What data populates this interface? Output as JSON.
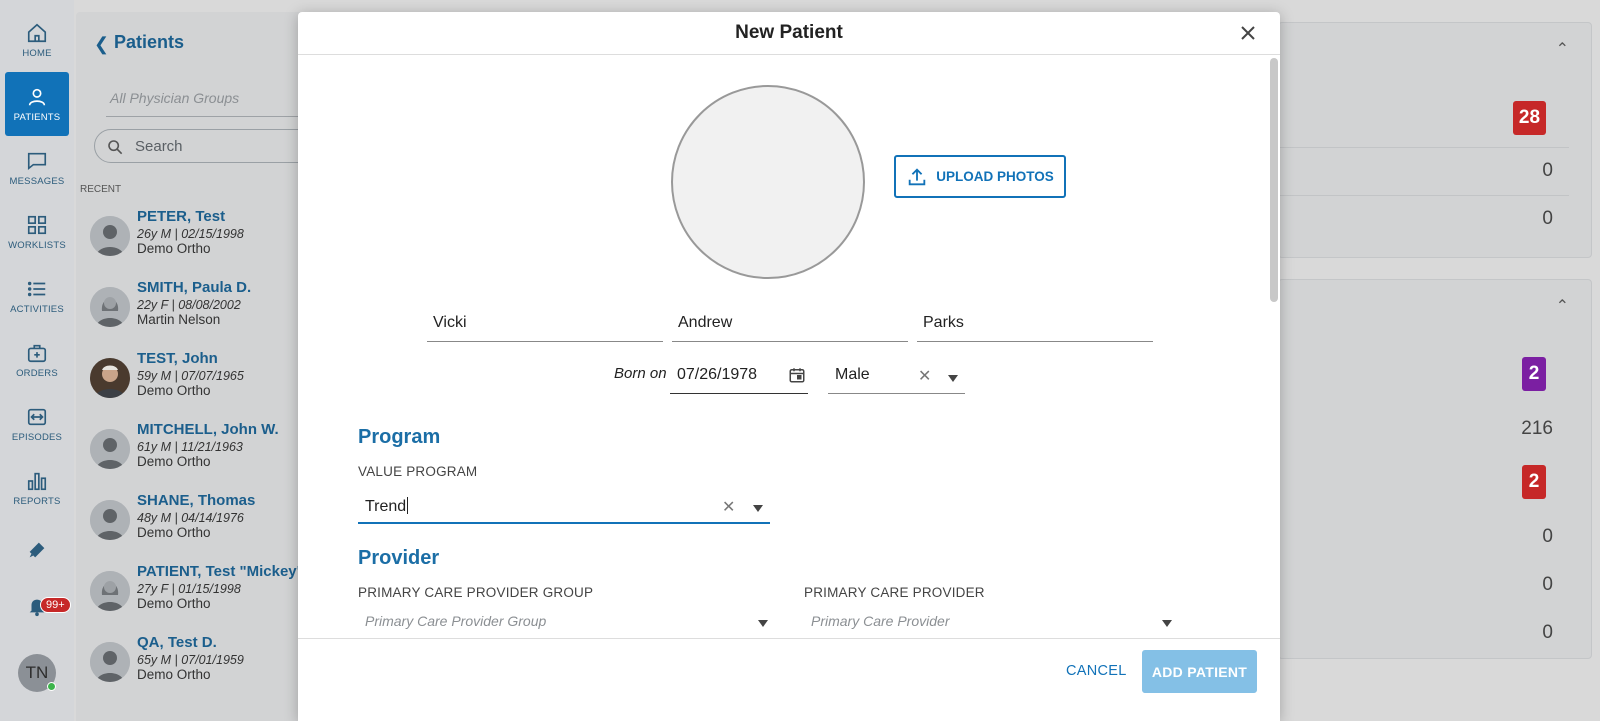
{
  "nav": {
    "items": [
      {
        "label": "HOME",
        "icon": "home-icon"
      },
      {
        "label": "PATIENTS",
        "icon": "person-icon"
      },
      {
        "label": "MESSAGES",
        "icon": "chat-icon"
      },
      {
        "label": "WORKLISTS",
        "icon": "grid-icon"
      },
      {
        "label": "ACTIVITIES",
        "icon": "list-icon"
      },
      {
        "label": "ORDERS",
        "icon": "medkit-icon"
      },
      {
        "label": "EPISODES",
        "icon": "episodes-icon"
      },
      {
        "label": "REPORTS",
        "icon": "bar-chart-icon"
      }
    ],
    "notifications_badge": "99+",
    "user_initials": "TN",
    "active_color": "#1172b8"
  },
  "patients_panel": {
    "title": "Patients",
    "physician_groups_placeholder": "All Physician Groups",
    "search_placeholder": "Search",
    "recent_label": "RECENT",
    "items": [
      {
        "name": "PETER, Test",
        "meta": "26y M | 02/15/1998",
        "org": "Demo Ortho"
      },
      {
        "name": "SMITH, Paula D.",
        "meta": "22y F | 08/08/2002",
        "org": "Martin Nelson"
      },
      {
        "name": "TEST, John",
        "meta": "59y M | 07/07/1965",
        "org": "Demo Ortho"
      },
      {
        "name": "MITCHELL, John W.",
        "meta": "61y M | 11/21/1963",
        "org": "Demo Ortho"
      },
      {
        "name": "SHANE, Thomas",
        "meta": "48y M | 04/14/1976",
        "org": "Demo Ortho"
      },
      {
        "name": "PATIENT, Test \"Mickey\"",
        "meta": "27y F | 01/15/1998",
        "org": "Demo Ortho"
      },
      {
        "name": "QA, Test D.",
        "meta": "65y M | 07/01/1959",
        "org": "Demo Ortho"
      }
    ]
  },
  "right_cards": {
    "card1": {
      "values": [
        "28",
        "0",
        "0"
      ],
      "badge_color": "#c62828"
    },
    "card2": {
      "values": [
        "2",
        "216",
        "2",
        "0",
        "0",
        "0"
      ],
      "badge_colors": [
        "#7b1fa2",
        "#c62828"
      ]
    }
  },
  "modal": {
    "title": "New Patient",
    "upload_label": "UPLOAD PHOTOS",
    "first_name": "Vicki",
    "middle_name": "Andrew",
    "last_name": "Parks",
    "born_on_label": "Born on",
    "dob": "07/26/1978",
    "sex": "Male",
    "program_heading": "Program",
    "value_program_label": "VALUE PROGRAM",
    "value_program_input": "Trend",
    "provider_heading": "Provider",
    "pcp_group_label": "PRIMARY CARE PROVIDER GROUP",
    "pcp_group_placeholder": "Primary Care Provider Group",
    "pcp_label": "PRIMARY CARE PROVIDER",
    "pcp_placeholder": "Primary Care Provider",
    "cancel_label": "CANCEL",
    "add_label": "ADD PATIENT"
  }
}
